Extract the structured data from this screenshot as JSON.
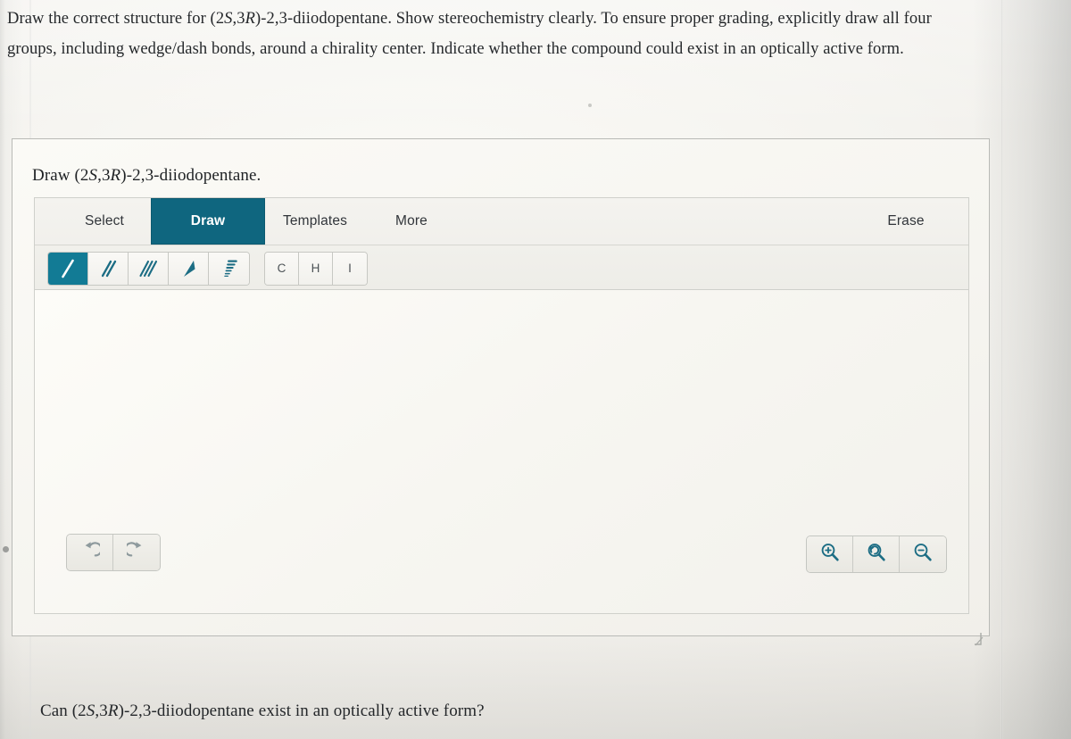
{
  "prompt": {
    "line1_a": "Draw the correct structure for (2",
    "line1_s": "S",
    "line1_b": ",3",
    "line1_r": "R",
    "line1_c": ")-2,3-diiodopentane. Show stereochemistry clearly. To ensure proper grading, explicitly draw all four groups, including wedge/dash bonds, around a chirality center. Indicate whether the compound could exist in an optically active form.",
    "full_text": "Draw the correct structure for (2S,3R)-2,3-diiodopentane. Show stereochemistry clearly. To ensure proper grading, explicitly draw all four groups, including wedge/dash bonds, around a chirality center. Indicate whether the compound could exist in an optically active form."
  },
  "card": {
    "title_a": "Draw (2",
    "title_s": "S",
    "title_b": ",3",
    "title_r": "R",
    "title_c": ")-2,3-diiodopentane.",
    "title_full": "Draw (2S,3R)-2,3-diiodopentane."
  },
  "toolbar": {
    "tabs": [
      {
        "label": "Select",
        "active": false
      },
      {
        "label": "Draw",
        "active": true
      },
      {
        "label": "Templates",
        "active": false
      },
      {
        "label": "More",
        "active": false
      }
    ],
    "erase_label": "Erase",
    "bond_tools": [
      {
        "name": "single-bond-tool",
        "icon": "single-bond-icon",
        "selected": true
      },
      {
        "name": "double-bond-tool",
        "icon": "double-bond-icon",
        "selected": false
      },
      {
        "name": "triple-bond-tool",
        "icon": "triple-bond-icon",
        "selected": false
      },
      {
        "name": "wedge-bond-tool",
        "icon": "wedge-bond-icon",
        "selected": false
      },
      {
        "name": "hash-bond-tool",
        "icon": "hash-bond-icon",
        "selected": false
      }
    ],
    "element_tools": [
      {
        "label": "C",
        "name": "carbon-element-button"
      },
      {
        "label": "H",
        "name": "hydrogen-element-button"
      },
      {
        "label": "I",
        "name": "iodine-element-button"
      }
    ]
  },
  "canvas": {
    "history_buttons": [
      {
        "name": "undo-button",
        "icon": "undo-arrow-icon"
      },
      {
        "name": "redo-button",
        "icon": "redo-arrow-icon"
      }
    ],
    "zoom_buttons": [
      {
        "name": "zoom-in-button",
        "icon": "magnifier-plus-icon"
      },
      {
        "name": "zoom-reset-button",
        "icon": "magnifier-reset-icon"
      },
      {
        "name": "zoom-out-button",
        "icon": "magnifier-minus-icon"
      }
    ]
  },
  "bottom_question": {
    "text_a": "Can (2",
    "text_s": "S",
    "text_b": ",3",
    "text_r": "R",
    "text_c": ")-2,3-diiodopentane exist in an optically active form?",
    "full_text": "Can (2S,3R)-2,3-diiodopentane exist in an optically active form?"
  },
  "colors": {
    "accent_teal": "#0f667f",
    "tool_selected_teal": "#127b95",
    "icon_teal": "#1c6d84",
    "page_background": "#f4f3ef",
    "border_grey": "#c7c8c3"
  }
}
